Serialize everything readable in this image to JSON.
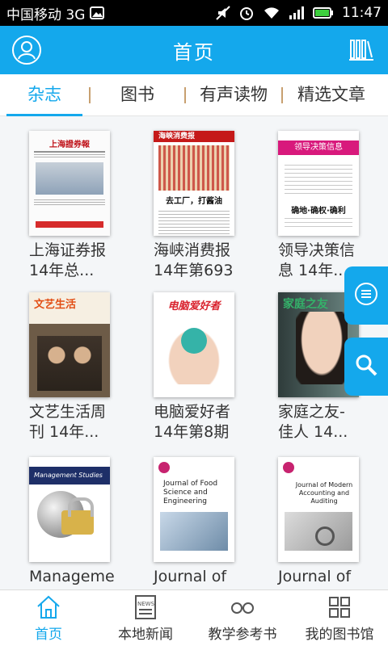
{
  "status_bar": {
    "carrier": "中国移动 3G",
    "time": "11:47"
  },
  "header": {
    "title": "首页",
    "accent_color": "#14a8ec",
    "left_icon": "profile-icon",
    "right_icon": "bookshelf-icon"
  },
  "tabs": [
    {
      "label": "杂志",
      "active": true
    },
    {
      "label": "图书",
      "active": false
    },
    {
      "label": "有声读物",
      "active": false
    },
    {
      "label": "精选文章",
      "active": false
    }
  ],
  "grid": {
    "items": [
      {
        "caption_l1": "上海证券报",
        "caption_l2": "14年总...",
        "cover_text": "上海證券報"
      },
      {
        "caption_l1": "海峡消费报",
        "caption_l2": "14年第693",
        "cover_text": "海峡消费报",
        "cover_headline": "去工厂，打酱油"
      },
      {
        "caption_l1": "领导决策信",
        "caption_l2": "息 14年...",
        "cover_text": "领导决策信息",
        "cover_tag": "确地·确权·确利"
      },
      {
        "caption_l1": "文艺生活周",
        "caption_l2": "刊 14年...",
        "cover_text": "文艺生活"
      },
      {
        "caption_l1": "电脑爱好者",
        "caption_l2": "14年第8期",
        "cover_text": "电脑爱好者"
      },
      {
        "caption_l1": "家庭之友-",
        "caption_l2": "佳人 14...",
        "cover_text": "家庭之友"
      },
      {
        "caption_l1": "Manageme",
        "caption_l2": "",
        "cover_text": "Management Studies"
      },
      {
        "caption_l1": "Journal of",
        "caption_l2": "",
        "cover_text": "Journal of Food Science and Engineering"
      },
      {
        "caption_l1": "Journal of",
        "caption_l2": "",
        "cover_text": "Journal of Modern Accounting and Auditing"
      }
    ]
  },
  "floating": {
    "menu_icon": "list-menu-icon",
    "search_icon": "search-icon"
  },
  "bottom_nav": [
    {
      "label": "首页",
      "icon": "home-icon",
      "active": true
    },
    {
      "label": "本地新闻",
      "icon": "news-icon",
      "active": false
    },
    {
      "label": "教学参考书",
      "icon": "glasses-icon",
      "active": false
    },
    {
      "label": "我的图书馆",
      "icon": "library-icon",
      "active": false
    }
  ]
}
